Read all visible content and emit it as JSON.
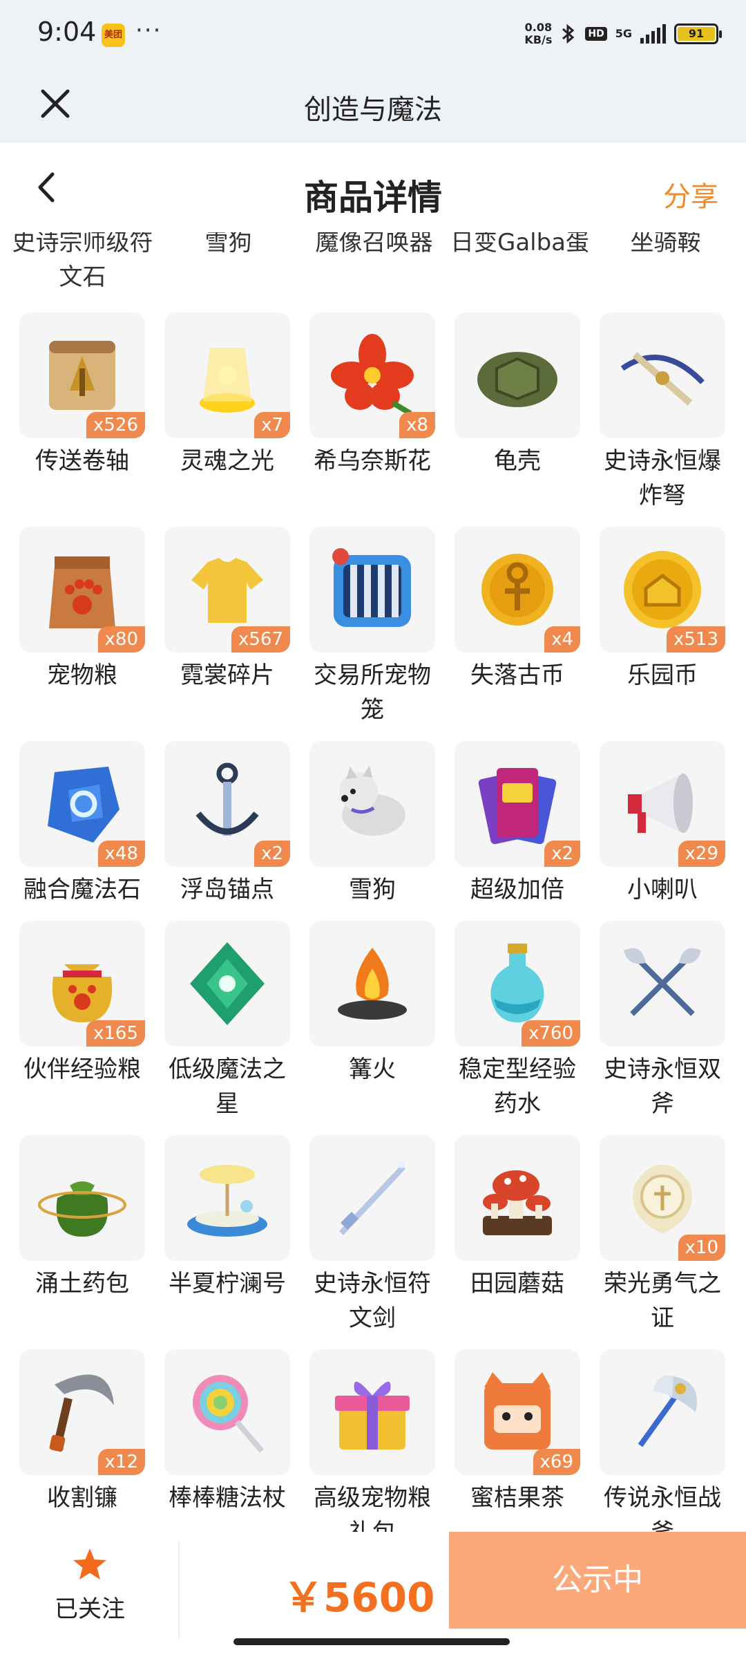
{
  "status": {
    "time": "9:04",
    "app_badge": "美团",
    "dots": "···",
    "speed_value": "0.08",
    "speed_unit": "KB/s",
    "hd": "HD",
    "network": "5G",
    "battery": "91"
  },
  "titlebar": {
    "title": "创造与魔法"
  },
  "header": {
    "title": "商品详情",
    "share_label": "分享"
  },
  "partial_row": [
    "史诗宗师级符文石",
    "雪狗",
    "魔像召唤器",
    "日变Galba蛋",
    "坐骑鞍"
  ],
  "items": [
    {
      "name": "传送卷轴",
      "count": "x526",
      "icon": "scroll-icon"
    },
    {
      "name": "灵魂之光",
      "count": "x7",
      "icon": "soul-light-icon"
    },
    {
      "name": "希乌奈斯花",
      "count": "x8",
      "icon": "flower-icon"
    },
    {
      "name": "龟壳",
      "count": "",
      "icon": "turtle-shell-icon"
    },
    {
      "name": "史诗永恒爆炸弩",
      "count": "",
      "icon": "crossbow-icon"
    },
    {
      "name": "宠物粮",
      "count": "x80",
      "icon": "pet-food-bag-icon"
    },
    {
      "name": "霓裳碎片",
      "count": "x567",
      "icon": "shirt-icon"
    },
    {
      "name": "交易所宠物笼",
      "count": "",
      "icon": "pet-cage-icon"
    },
    {
      "name": "失落古币",
      "count": "x4",
      "icon": "ancient-coin-icon"
    },
    {
      "name": "乐园币",
      "count": "x513",
      "icon": "gold-coin-icon"
    },
    {
      "name": "融合魔法石",
      "count": "x48",
      "icon": "magic-stone-icon"
    },
    {
      "name": "浮岛锚点",
      "count": "x2",
      "icon": "anchor-icon"
    },
    {
      "name": "雪狗",
      "count": "",
      "icon": "snow-dog-icon"
    },
    {
      "name": "超级加倍",
      "count": "x2",
      "icon": "cards-icon"
    },
    {
      "name": "小喇叭",
      "count": "x29",
      "icon": "megaphone-icon"
    },
    {
      "name": "伙伴经验粮",
      "count": "x165",
      "icon": "exp-bag-icon"
    },
    {
      "name": "低级魔法之星",
      "count": "",
      "icon": "green-gem-icon"
    },
    {
      "name": "篝火",
      "count": "",
      "icon": "bonfire-icon"
    },
    {
      "name": "稳定型经验药水",
      "count": "x760",
      "icon": "potion-icon"
    },
    {
      "name": "史诗永恒双斧",
      "count": "",
      "icon": "double-axe-icon"
    },
    {
      "name": "涌土药包",
      "count": "",
      "icon": "herb-pouch-icon"
    },
    {
      "name": "半夏柠澜号",
      "count": "",
      "icon": "boat-icon"
    },
    {
      "name": "史诗永恒符文剑",
      "count": "",
      "icon": "sword-icon"
    },
    {
      "name": "田园蘑菇",
      "count": "",
      "icon": "mushroom-icon"
    },
    {
      "name": "荣光勇气之证",
      "count": "x10",
      "icon": "emblem-icon"
    },
    {
      "name": "收割镰",
      "count": "x12",
      "icon": "sickle-icon"
    },
    {
      "name": "棒棒糖法杖",
      "count": "",
      "icon": "lollipop-icon"
    },
    {
      "name": "高级宠物粮礼包",
      "count": "",
      "icon": "gift-box-icon"
    },
    {
      "name": "蜜桔果茶",
      "count": "x69",
      "icon": "orange-cat-icon"
    },
    {
      "name": "传说永恒战斧",
      "count": "",
      "icon": "battle-axe-icon"
    }
  ],
  "bottom": {
    "follow_label": "已关注",
    "price": "￥5600",
    "action_label": "公示中"
  },
  "colors": {
    "accent": "#f08a2c",
    "badge": "#f0894d",
    "action_bg": "#fba87a",
    "price": "#f2701f"
  }
}
